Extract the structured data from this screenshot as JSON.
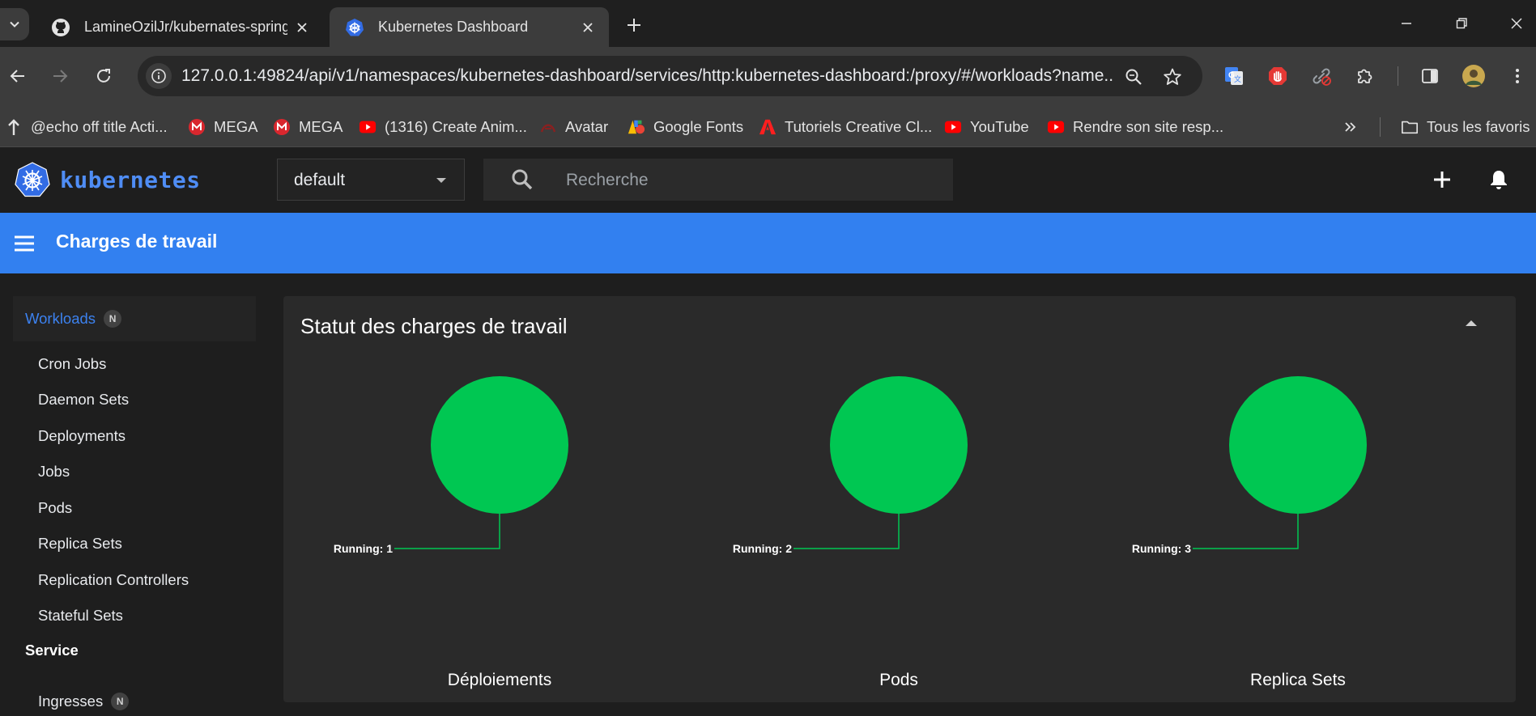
{
  "browser": {
    "tabs": [
      {
        "title": "LamineOzilJr/kubernates-spring",
        "active": false,
        "icon": "github-icon"
      },
      {
        "title": "Kubernetes Dashboard",
        "active": true,
        "icon": "kubernetes-icon"
      }
    ],
    "url": "127.0.0.1:49824/api/v1/namespaces/kubernetes-dashboard/services/http:kubernetes-dashboard:/proxy/#/workloads?name...",
    "bookmarks": [
      {
        "label": "@echo off title Acti...",
        "icon": "arrow-up-icon"
      },
      {
        "label": "MEGA",
        "icon": "mega-icon"
      },
      {
        "label": "MEGA",
        "icon": "mega-icon"
      },
      {
        "label": "(1316) Create Anim...",
        "icon": "youtube-icon"
      },
      {
        "label": "Avatar",
        "icon": "avatar-icon"
      },
      {
        "label": "Google Fonts",
        "icon": "google-fonts-icon"
      },
      {
        "label": "Tutoriels Creative Cl...",
        "icon": "adobe-icon"
      },
      {
        "label": "YouTube",
        "icon": "youtube-icon"
      },
      {
        "label": "Rendre son site resp...",
        "icon": "youtube-icon"
      }
    ],
    "all_bookmarks_label": "Tous les favoris"
  },
  "header": {
    "logo_text": "kubernetes",
    "namespace": "default",
    "search_placeholder": "Recherche"
  },
  "titlebar": {
    "title": "Charges de travail"
  },
  "sidebar": {
    "workloads_label": "Workloads",
    "workloads_badge": "N",
    "items": [
      "Cron Jobs",
      "Daemon Sets",
      "Deployments",
      "Jobs",
      "Pods",
      "Replica Sets",
      "Replication Controllers",
      "Stateful Sets"
    ],
    "service_label": "Service",
    "ingresses_label": "Ingresses",
    "ingresses_badge": "N"
  },
  "card": {
    "title": "Statut des charges de travail"
  },
  "chart_data": [
    {
      "type": "pie",
      "title": "Déploiements",
      "slices": [
        {
          "label": "Running",
          "value": 1,
          "color": "#00c752"
        }
      ],
      "label_text": "Running: 1"
    },
    {
      "type": "pie",
      "title": "Pods",
      "slices": [
        {
          "label": "Running",
          "value": 2,
          "color": "#00c752"
        }
      ],
      "label_text": "Running: 2"
    },
    {
      "type": "pie",
      "title": "Replica Sets",
      "slices": [
        {
          "label": "Running",
          "value": 3,
          "color": "#00c752"
        }
      ],
      "label_text": "Running: 3"
    }
  ],
  "colors": {
    "accent": "#3280f0",
    "running": "#00c752"
  }
}
